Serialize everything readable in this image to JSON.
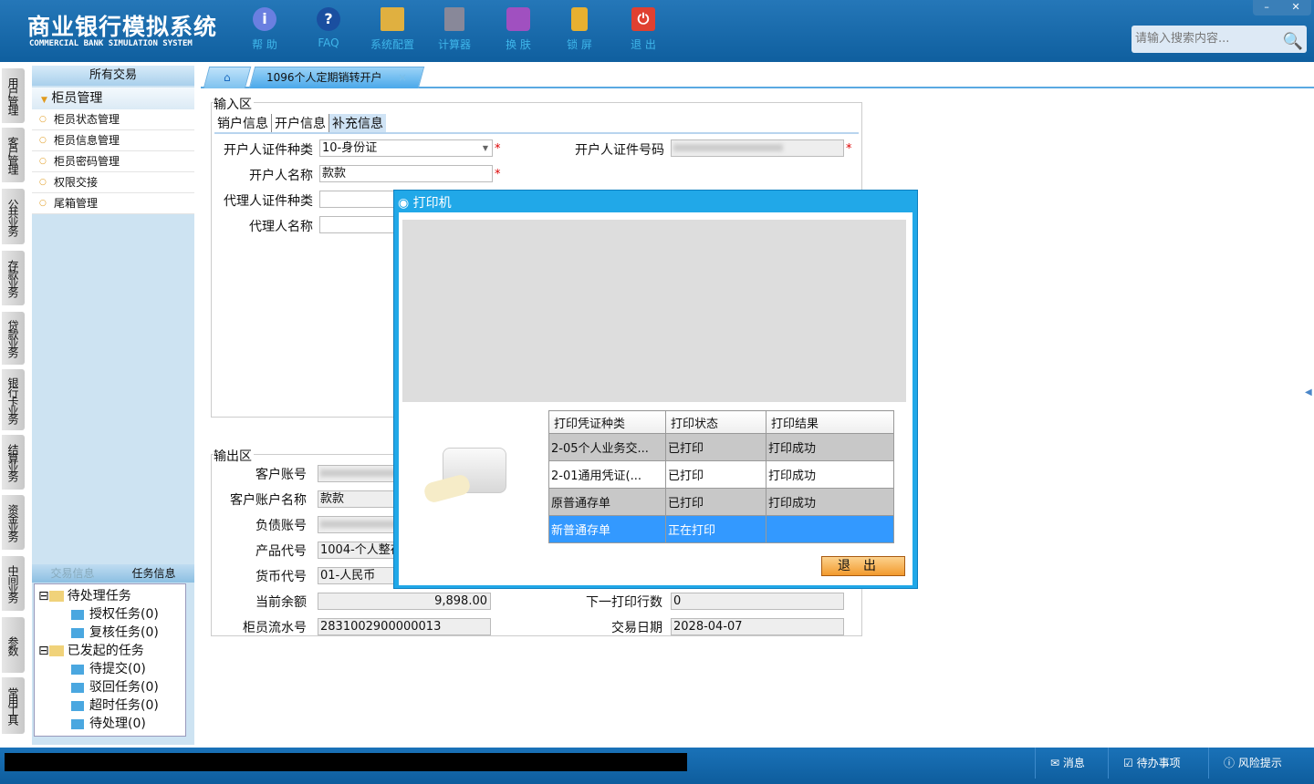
{
  "app": {
    "title_cn": "商业银行模拟系统",
    "title_en": "COMMERCIAL BANK SIMULATION SYSTEM"
  },
  "toolbar": [
    {
      "label": "帮 助",
      "icon": "info-icon"
    },
    {
      "label": "FAQ",
      "icon": "question-icon"
    },
    {
      "label": "系统配置",
      "icon": "toolbox-icon"
    },
    {
      "label": "计算器",
      "icon": "calculator-icon"
    },
    {
      "label": "换 肤",
      "icon": "shirt-icon"
    },
    {
      "label": "锁 屏",
      "icon": "lock-icon"
    },
    {
      "label": "退 出",
      "icon": "power-icon"
    }
  ],
  "window": {
    "minimize": "–",
    "close": "✕"
  },
  "search": {
    "placeholder": "请输入搜索内容..."
  },
  "vtabs": [
    "用户管理",
    "客户管理",
    "公共业务",
    "存款业务",
    "贷款业务",
    "银行卡业务",
    "结算业务",
    "资金业务",
    "中间业务",
    "参数",
    "常用工具"
  ],
  "left": {
    "header": "所有交易",
    "group": "柜员管理",
    "items": [
      "柜员状态管理",
      "柜员信息管理",
      "柜员密码管理",
      "权限交接",
      "尾箱管理"
    ],
    "tabs": [
      "交易信息",
      "任务信息"
    ],
    "tree": [
      {
        "label": "待处理任务",
        "children": [
          "授权任务(0)",
          "复核任务(0)"
        ]
      },
      {
        "label": "已发起的任务",
        "children": [
          "待提交(0)",
          "驳回任务(0)",
          "超时任务(0)",
          "待处理(0)"
        ]
      }
    ]
  },
  "tabs": {
    "active": "1096个人定期销转开户",
    "close": "×"
  },
  "input": {
    "legend": "输入区",
    "subtabs": [
      "销户信息",
      "开户信息",
      "补充信息"
    ],
    "fields": {
      "id_type_label": "开户人证件种类",
      "id_type": "10-身份证",
      "id_no_label": "开户人证件号码",
      "name_label": "开户人名称",
      "name": "款款",
      "agent_id_type_label": "代理人证件种类",
      "agent_name_label": "代理人名称"
    },
    "required": "*"
  },
  "output": {
    "legend": "输出区",
    "fields": {
      "acct_label": "客户账号",
      "acct_name_label": "客户账户名称",
      "acct_name": "款款",
      "liab_label": "负债账号",
      "product_label": "产品代号",
      "product": "1004-个人整存",
      "currency_label": "货币代号",
      "currency": "01-人民币",
      "balance_label": "当前余额",
      "balance": "9,898.00",
      "next_line_label": "下一打印行数",
      "next_line": "0",
      "serial_label": "柜员流水号",
      "serial": "2831002900000013",
      "date_label": "交易日期",
      "date": "2028-04-07"
    }
  },
  "printer": {
    "title": "打印机",
    "columns": [
      "打印凭证种类",
      "打印状态",
      "打印结果"
    ],
    "rows": [
      [
        "2-05个人业务交...",
        "已打印",
        "打印成功"
      ],
      [
        "2-01通用凭证(...",
        "已打印",
        "打印成功"
      ],
      [
        "原普通存单",
        "已打印",
        "打印成功"
      ],
      [
        "新普通存单",
        "正在打印",
        ""
      ]
    ],
    "exit": "退出",
    "selected_color": "#3399ff"
  },
  "status": {
    "items": [
      "消息",
      "待办事项",
      "风险提示"
    ]
  }
}
